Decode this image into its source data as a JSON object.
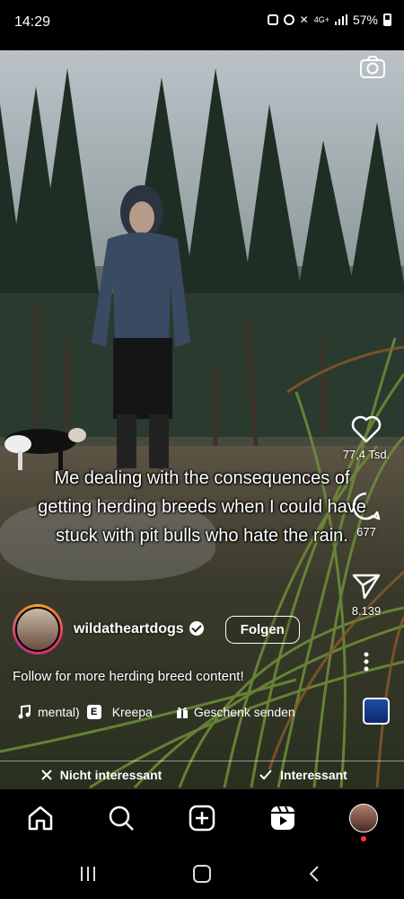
{
  "status_bar": {
    "time": "14:29",
    "battery": "57%",
    "network": "4G+"
  },
  "post": {
    "caption_lines": [
      "Me dealing with the consequences of",
      "getting herding breeds when I could have",
      "stuck with pit bulls who hate the rain."
    ],
    "username": "wildatheartdogs",
    "follow_label": "Folgen",
    "description": "Follow for more herding breed content!",
    "music_text": "mental)",
    "music_badge": "E",
    "music_artist": "Kreepa",
    "gift_label": "Geschenk senden"
  },
  "actions": {
    "likes": "77,4 Tsd.",
    "comments": "677",
    "shares": "8.139"
  },
  "feedback": {
    "not_interested": "Nicht interessant",
    "interested": "Interessant"
  },
  "icons": [
    "camera-icon",
    "heart-icon",
    "comment-icon",
    "share-icon",
    "more-icon",
    "music-icon",
    "gift-icon",
    "close-icon",
    "check-icon",
    "home-icon",
    "search-icon",
    "create-icon",
    "reels-icon",
    "recent-apps-icon",
    "home-button-icon",
    "back-icon"
  ]
}
